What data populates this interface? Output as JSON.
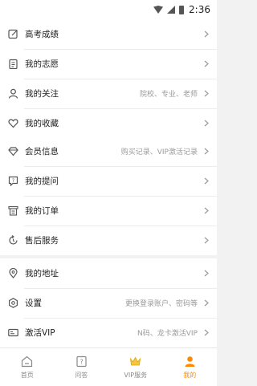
{
  "status_bar": {
    "time": "2:36"
  },
  "group1": [
    {
      "label": "高考成绩",
      "hint": ""
    },
    {
      "label": "我的志愿",
      "hint": ""
    },
    {
      "label": "我的关注",
      "hint": "院校、专业、老师"
    },
    {
      "label": "我的收藏",
      "hint": ""
    }
  ],
  "group2": [
    {
      "label": "会员信息",
      "hint": "购买记录、VIP激活记录"
    },
    {
      "label": "我的提问",
      "hint": ""
    },
    {
      "label": "我的订单",
      "hint": ""
    },
    {
      "label": "售后服务",
      "hint": ""
    }
  ],
  "group3": [
    {
      "label": "我的地址",
      "hint": ""
    },
    {
      "label": "设置",
      "hint": "更换登录账户、密码等"
    },
    {
      "label": "激活VIP",
      "hint": "N码、龙卡激活VIP"
    }
  ],
  "tabbar": [
    {
      "label": "首页"
    },
    {
      "label": "问答"
    },
    {
      "label": "VIP服务"
    },
    {
      "label": "我的"
    }
  ],
  "colors": {
    "accent": "#ff8a00",
    "icon": "#555555",
    "hint": "#9a9a9a"
  }
}
